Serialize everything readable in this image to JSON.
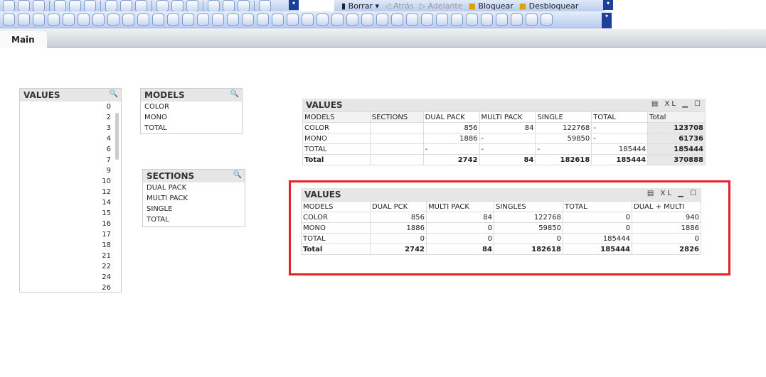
{
  "toolbar": {
    "borrar": "Borrar",
    "atras": "Atrás",
    "adelante": "Adelante",
    "bloquear": "Bloquear",
    "desbloquear": "Desbloquear"
  },
  "tabs": [
    {
      "label": "Main"
    }
  ],
  "values_list": {
    "title": "VALUES",
    "items": [
      "0",
      "2",
      "3",
      "4",
      "6",
      "7",
      "9",
      "10",
      "12",
      "14",
      "15",
      "16",
      "17",
      "18",
      "21",
      "22",
      "24",
      "26"
    ]
  },
  "models_list": {
    "title": "MODELS",
    "items": [
      "COLOR",
      "MONO",
      "TOTAL"
    ]
  },
  "sections_list": {
    "title": "SECTIONS",
    "items": [
      "DUAL PACK",
      "MULTI PACK",
      "SINGLE",
      "TOTAL"
    ]
  },
  "table1": {
    "title": "VALUES",
    "controls": "XL",
    "headers": [
      "MODELS",
      "SECTIONS",
      "DUAL PACK",
      "MULTI PACK",
      "SINGLE",
      "TOTAL",
      "Total"
    ],
    "rows": [
      [
        "COLOR",
        "",
        "856",
        "84",
        "122768",
        "-",
        "123708"
      ],
      [
        "MONO",
        "",
        "1886",
        "-",
        "59850",
        "-",
        "61736"
      ],
      [
        "TOTAL",
        "",
        "-",
        "-",
        "-",
        "185444",
        "185444"
      ],
      [
        "Total",
        "",
        "2742",
        "84",
        "182618",
        "185444",
        "370888"
      ]
    ]
  },
  "table2": {
    "title": "VALUES",
    "controls": "XL",
    "headers": [
      "MODELS",
      "DUAL PCK",
      "MULTI PACK",
      "SINGLES",
      "TOTAL",
      "DUAL + MULTI"
    ],
    "rows": [
      [
        "COLOR",
        "856",
        "84",
        "122768",
        "0",
        "940"
      ],
      [
        "MONO",
        "1886",
        "0",
        "59850",
        "0",
        "1886"
      ],
      [
        "TOTAL",
        "0",
        "0",
        "0",
        "185444",
        "0"
      ],
      [
        "Total",
        "2742",
        "84",
        "182618",
        "185444",
        "2826"
      ]
    ]
  },
  "highlight_color": "#e3212b"
}
